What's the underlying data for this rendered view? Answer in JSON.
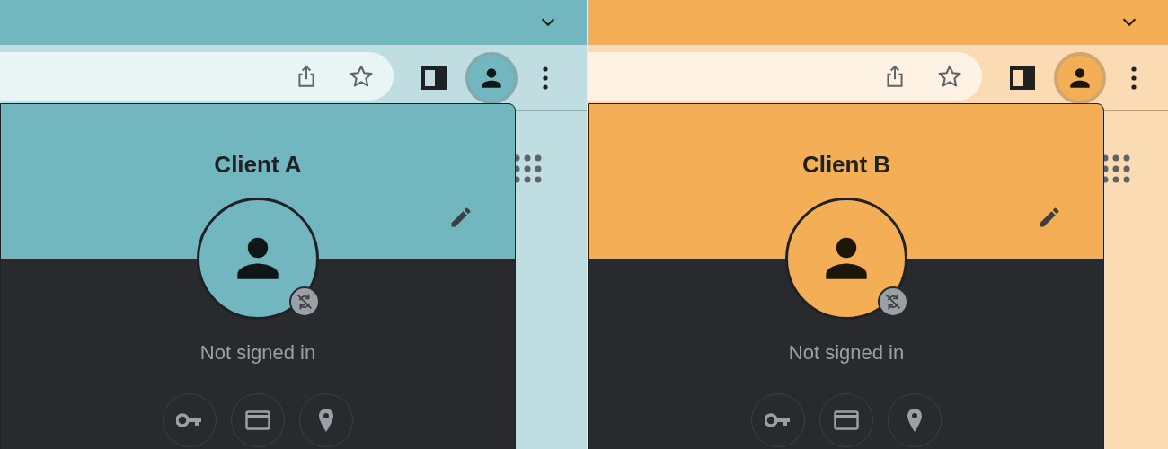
{
  "windows": [
    {
      "color": "#72b6bf",
      "profile_title": "Client A",
      "status": "Not signed in"
    },
    {
      "color": "#f4ae55",
      "profile_title": "Client B",
      "status": "Not signed in"
    }
  ]
}
